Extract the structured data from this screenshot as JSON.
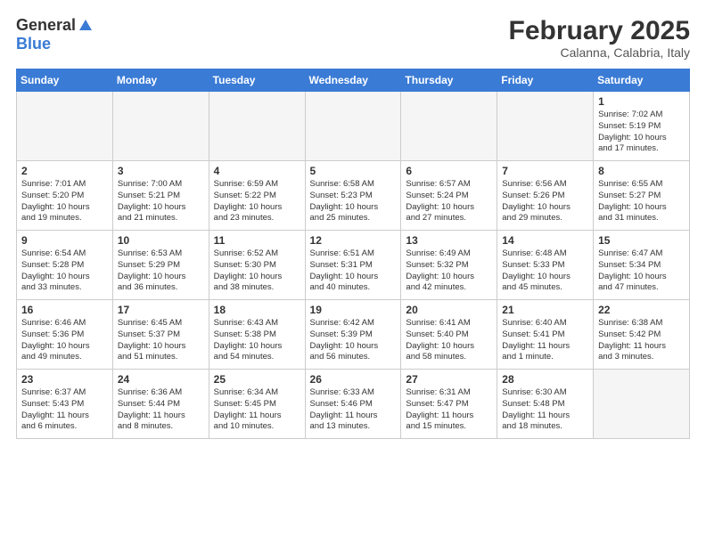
{
  "header": {
    "logo_general": "General",
    "logo_blue": "Blue",
    "month_title": "February 2025",
    "location": "Calanna, Calabria, Italy"
  },
  "weekdays": [
    "Sunday",
    "Monday",
    "Tuesday",
    "Wednesday",
    "Thursday",
    "Friday",
    "Saturday"
  ],
  "weeks": [
    [
      {
        "day": "",
        "info": ""
      },
      {
        "day": "",
        "info": ""
      },
      {
        "day": "",
        "info": ""
      },
      {
        "day": "",
        "info": ""
      },
      {
        "day": "",
        "info": ""
      },
      {
        "day": "",
        "info": ""
      },
      {
        "day": "1",
        "info": "Sunrise: 7:02 AM\nSunset: 5:19 PM\nDaylight: 10 hours\nand 17 minutes."
      }
    ],
    [
      {
        "day": "2",
        "info": "Sunrise: 7:01 AM\nSunset: 5:20 PM\nDaylight: 10 hours\nand 19 minutes."
      },
      {
        "day": "3",
        "info": "Sunrise: 7:00 AM\nSunset: 5:21 PM\nDaylight: 10 hours\nand 21 minutes."
      },
      {
        "day": "4",
        "info": "Sunrise: 6:59 AM\nSunset: 5:22 PM\nDaylight: 10 hours\nand 23 minutes."
      },
      {
        "day": "5",
        "info": "Sunrise: 6:58 AM\nSunset: 5:23 PM\nDaylight: 10 hours\nand 25 minutes."
      },
      {
        "day": "6",
        "info": "Sunrise: 6:57 AM\nSunset: 5:24 PM\nDaylight: 10 hours\nand 27 minutes."
      },
      {
        "day": "7",
        "info": "Sunrise: 6:56 AM\nSunset: 5:26 PM\nDaylight: 10 hours\nand 29 minutes."
      },
      {
        "day": "8",
        "info": "Sunrise: 6:55 AM\nSunset: 5:27 PM\nDaylight: 10 hours\nand 31 minutes."
      }
    ],
    [
      {
        "day": "9",
        "info": "Sunrise: 6:54 AM\nSunset: 5:28 PM\nDaylight: 10 hours\nand 33 minutes."
      },
      {
        "day": "10",
        "info": "Sunrise: 6:53 AM\nSunset: 5:29 PM\nDaylight: 10 hours\nand 36 minutes."
      },
      {
        "day": "11",
        "info": "Sunrise: 6:52 AM\nSunset: 5:30 PM\nDaylight: 10 hours\nand 38 minutes."
      },
      {
        "day": "12",
        "info": "Sunrise: 6:51 AM\nSunset: 5:31 PM\nDaylight: 10 hours\nand 40 minutes."
      },
      {
        "day": "13",
        "info": "Sunrise: 6:49 AM\nSunset: 5:32 PM\nDaylight: 10 hours\nand 42 minutes."
      },
      {
        "day": "14",
        "info": "Sunrise: 6:48 AM\nSunset: 5:33 PM\nDaylight: 10 hours\nand 45 minutes."
      },
      {
        "day": "15",
        "info": "Sunrise: 6:47 AM\nSunset: 5:34 PM\nDaylight: 10 hours\nand 47 minutes."
      }
    ],
    [
      {
        "day": "16",
        "info": "Sunrise: 6:46 AM\nSunset: 5:36 PM\nDaylight: 10 hours\nand 49 minutes."
      },
      {
        "day": "17",
        "info": "Sunrise: 6:45 AM\nSunset: 5:37 PM\nDaylight: 10 hours\nand 51 minutes."
      },
      {
        "day": "18",
        "info": "Sunrise: 6:43 AM\nSunset: 5:38 PM\nDaylight: 10 hours\nand 54 minutes."
      },
      {
        "day": "19",
        "info": "Sunrise: 6:42 AM\nSunset: 5:39 PM\nDaylight: 10 hours\nand 56 minutes."
      },
      {
        "day": "20",
        "info": "Sunrise: 6:41 AM\nSunset: 5:40 PM\nDaylight: 10 hours\nand 58 minutes."
      },
      {
        "day": "21",
        "info": "Sunrise: 6:40 AM\nSunset: 5:41 PM\nDaylight: 11 hours\nand 1 minute."
      },
      {
        "day": "22",
        "info": "Sunrise: 6:38 AM\nSunset: 5:42 PM\nDaylight: 11 hours\nand 3 minutes."
      }
    ],
    [
      {
        "day": "23",
        "info": "Sunrise: 6:37 AM\nSunset: 5:43 PM\nDaylight: 11 hours\nand 6 minutes."
      },
      {
        "day": "24",
        "info": "Sunrise: 6:36 AM\nSunset: 5:44 PM\nDaylight: 11 hours\nand 8 minutes."
      },
      {
        "day": "25",
        "info": "Sunrise: 6:34 AM\nSunset: 5:45 PM\nDaylight: 11 hours\nand 10 minutes."
      },
      {
        "day": "26",
        "info": "Sunrise: 6:33 AM\nSunset: 5:46 PM\nDaylight: 11 hours\nand 13 minutes."
      },
      {
        "day": "27",
        "info": "Sunrise: 6:31 AM\nSunset: 5:47 PM\nDaylight: 11 hours\nand 15 minutes."
      },
      {
        "day": "28",
        "info": "Sunrise: 6:30 AM\nSunset: 5:48 PM\nDaylight: 11 hours\nand 18 minutes."
      },
      {
        "day": "",
        "info": ""
      }
    ]
  ]
}
